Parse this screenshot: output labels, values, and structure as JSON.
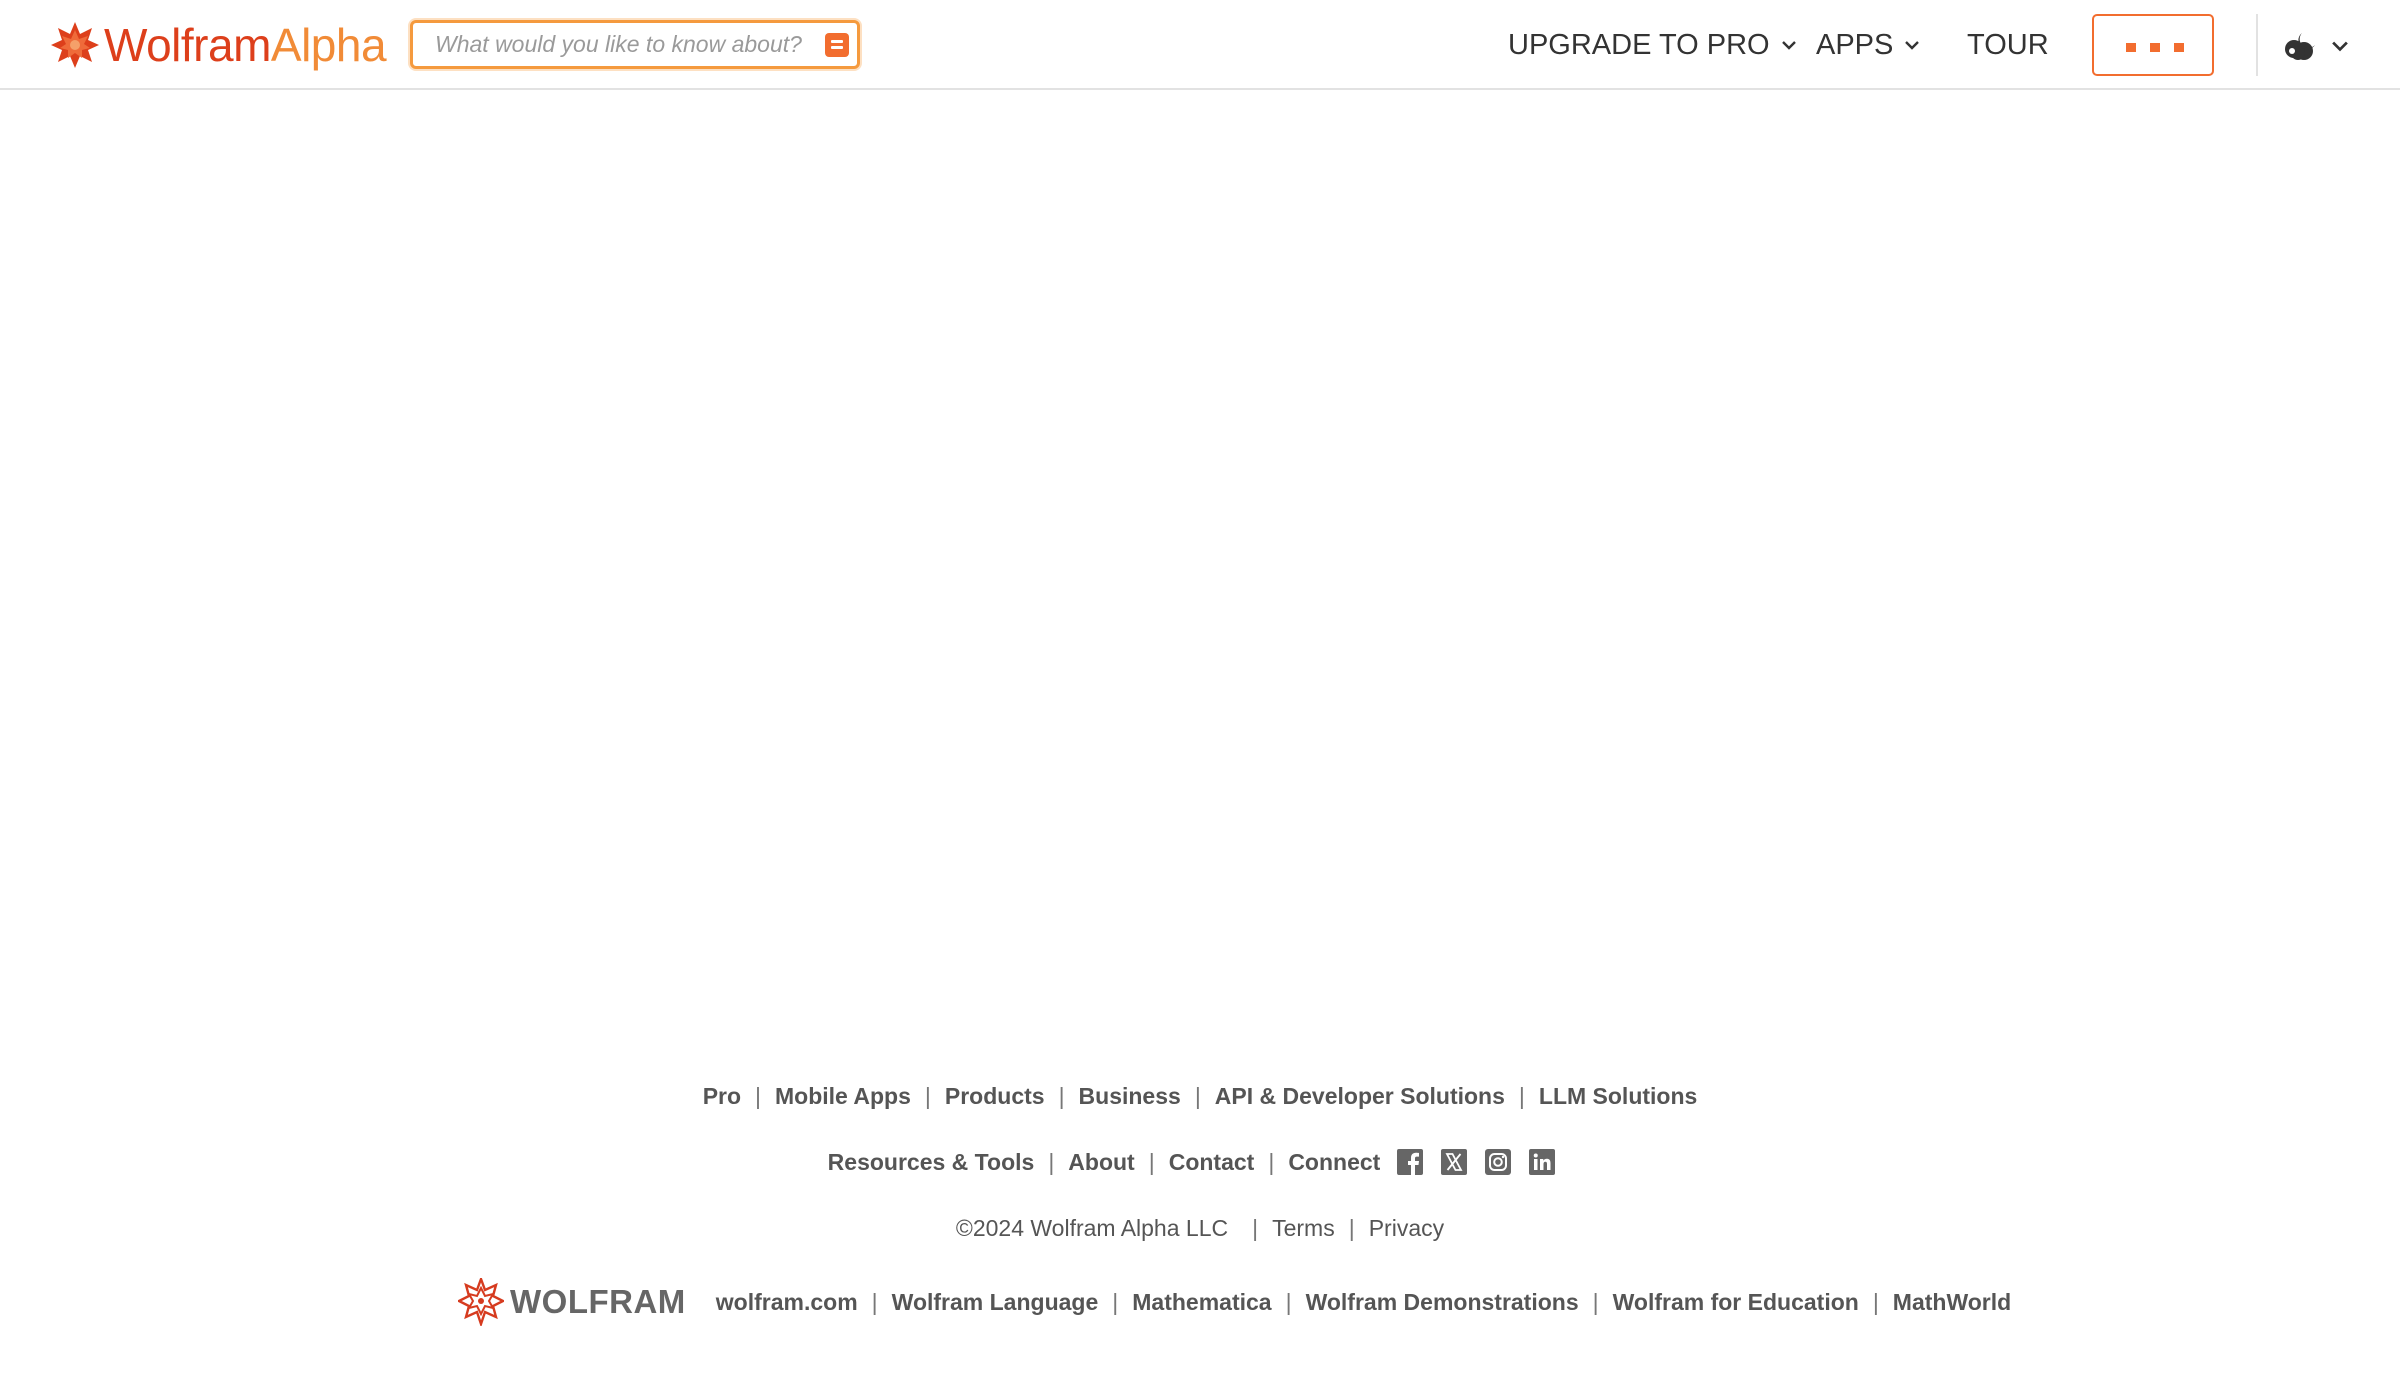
{
  "header": {
    "logo": {
      "part1": "Wolfram",
      "part2": "Alpha"
    },
    "search": {
      "placeholder": "What would you like to know about?"
    },
    "nav": {
      "upgrade": "UPGRADE TO PRO",
      "apps": "APPS",
      "tour": "TOUR"
    },
    "icons": [
      "wolfram-spikey-icon",
      "search-submit-icon",
      "chevron-down-icon",
      "more-icon",
      "theme-toggle-icon"
    ]
  },
  "footer": {
    "row1": [
      "Pro",
      "Mobile Apps",
      "Products",
      "Business",
      "API & Developer Solutions",
      "LLM Solutions"
    ],
    "row2": [
      "Resources & Tools",
      "About",
      "Contact",
      "Connect"
    ],
    "social_icons": [
      "facebook-icon",
      "x-icon",
      "instagram-icon",
      "linkedin-icon"
    ],
    "copyright": "©2024  Wolfram Alpha LLC",
    "legal": [
      "Terms",
      "Privacy"
    ],
    "wolfram_logo": "WOLFRAM",
    "row4": [
      "wolfram.com",
      "Wolfram Language",
      "Mathematica",
      "Wolfram Demonstrations",
      "Wolfram for Education",
      "MathWorld"
    ]
  },
  "colors": {
    "brand_red": "#dd3f1b",
    "brand_orange": "#f18b37",
    "accent": "#f26d2f",
    "footer_text": "#555555"
  }
}
